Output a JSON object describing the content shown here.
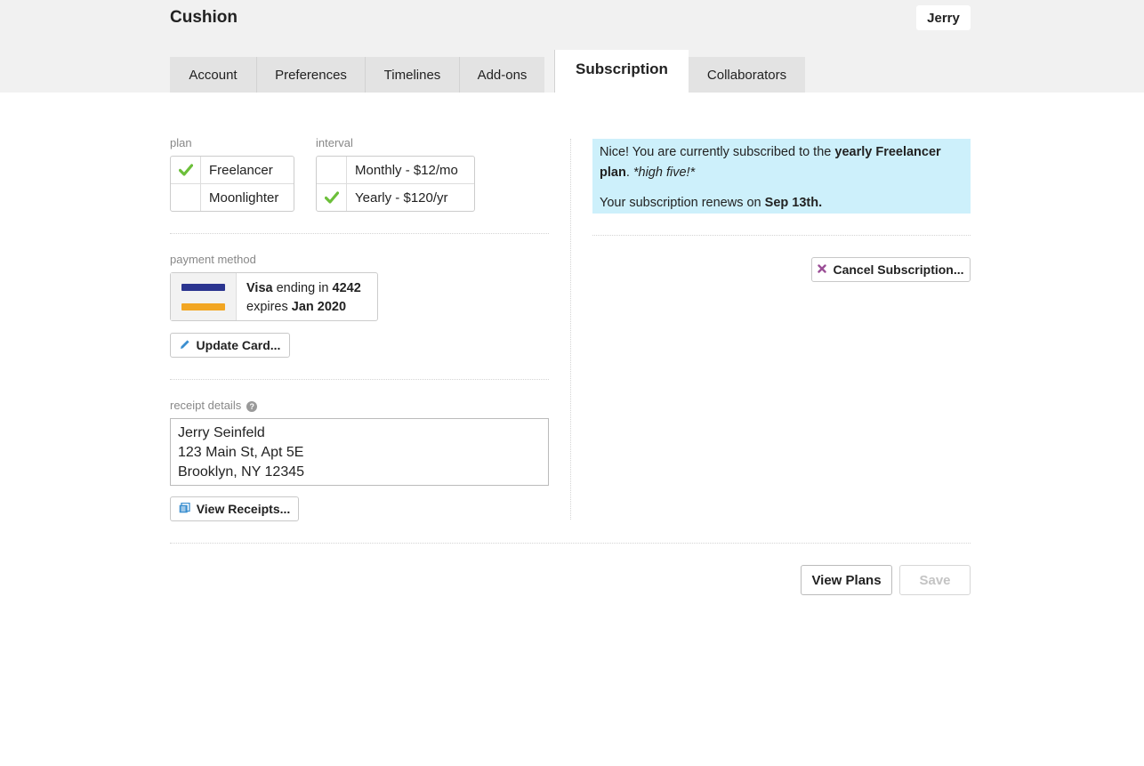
{
  "app": {
    "name": "Cushion",
    "user": "Jerry"
  },
  "tabs": [
    {
      "label": "Account"
    },
    {
      "label": "Preferences"
    },
    {
      "label": "Timelines"
    },
    {
      "label": "Add-ons"
    },
    {
      "label": "Subscription",
      "active": true
    },
    {
      "label": "Collaborators"
    }
  ],
  "plan": {
    "label": "plan",
    "options": [
      {
        "label": "Freelancer",
        "selected": true
      },
      {
        "label": "Moonlighter",
        "selected": false
      }
    ]
  },
  "interval": {
    "label": "interval",
    "options": [
      {
        "label": "Monthly - $12/mo",
        "selected": false
      },
      {
        "label": "Yearly - $120/yr",
        "selected": true
      }
    ]
  },
  "payment": {
    "label": "payment method",
    "brand": "Visa",
    "ending_text": "ending in",
    "last4": "4242",
    "expires_text": "expires",
    "expiry": "Jan 2020",
    "update_label": "Update Card..."
  },
  "receipt": {
    "label": "receipt details",
    "help_icon": "question-circle-icon",
    "lines": [
      "Jerry Seinfeld",
      "123 Main St, Apt 5E",
      "Brooklyn, NY 12345"
    ],
    "view_label": "View Receipts..."
  },
  "status": {
    "line1_prefix": "Nice! You are currently subscribed to the",
    "line1_bold": "yearly Freelancer plan",
    "line1_suffix": ". ",
    "line1_italic": "*high five!*",
    "line2_prefix": "Your subscription renews on",
    "line2_bold": "Sep 13th."
  },
  "cancel_label": "Cancel Subscription...",
  "footer": {
    "view_plans_label": "View Plans",
    "save_label": "Save",
    "save_disabled": true
  },
  "colors": {
    "check": "#6cbf3a",
    "notice_bg": "#cdf0fb",
    "card_top": "#2b3590",
    "card_bottom": "#f2a623",
    "cancel_x": "#9b4f96",
    "edit_icon": "#3b8fd0"
  }
}
